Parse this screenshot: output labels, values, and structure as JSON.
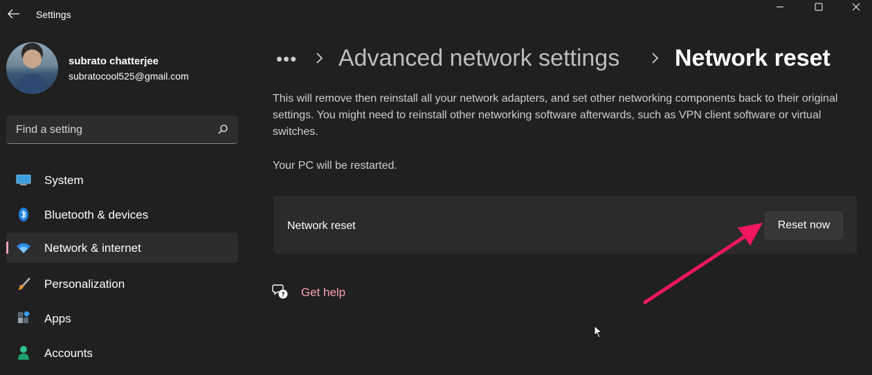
{
  "window": {
    "title": "Settings"
  },
  "profile": {
    "name": "subrato chatterjee",
    "email": "subratocool525@gmail.com"
  },
  "search": {
    "placeholder": "Find a setting",
    "icon": "search-icon"
  },
  "nav": {
    "items": [
      {
        "label": "System",
        "icon": "monitor-icon",
        "active": false
      },
      {
        "label": "Bluetooth & devices",
        "icon": "bluetooth-icon",
        "active": false
      },
      {
        "label": "Network & internet",
        "icon": "wifi-icon",
        "active": true
      },
      {
        "label": "Personalization",
        "icon": "brush-icon",
        "active": false
      },
      {
        "label": "Apps",
        "icon": "apps-icon",
        "active": false
      },
      {
        "label": "Accounts",
        "icon": "person-icon",
        "active": false
      }
    ]
  },
  "breadcrumb": {
    "overflow": "•••",
    "parent": "Advanced network settings",
    "current": "Network reset"
  },
  "content": {
    "description": "This will remove then reinstall all your network adapters, and set other networking components back to their original settings. You might need to reinstall other networking software afterwards, such as VPN client software or virtual switches.",
    "restart_note": "Your PC will be restarted.",
    "card": {
      "label": "Network reset",
      "button_label": "Reset now"
    },
    "help_link": "Get help"
  },
  "colors": {
    "background": "#202020",
    "accent": "#f7a1b5",
    "annotation_arrow": "#f0175f"
  }
}
